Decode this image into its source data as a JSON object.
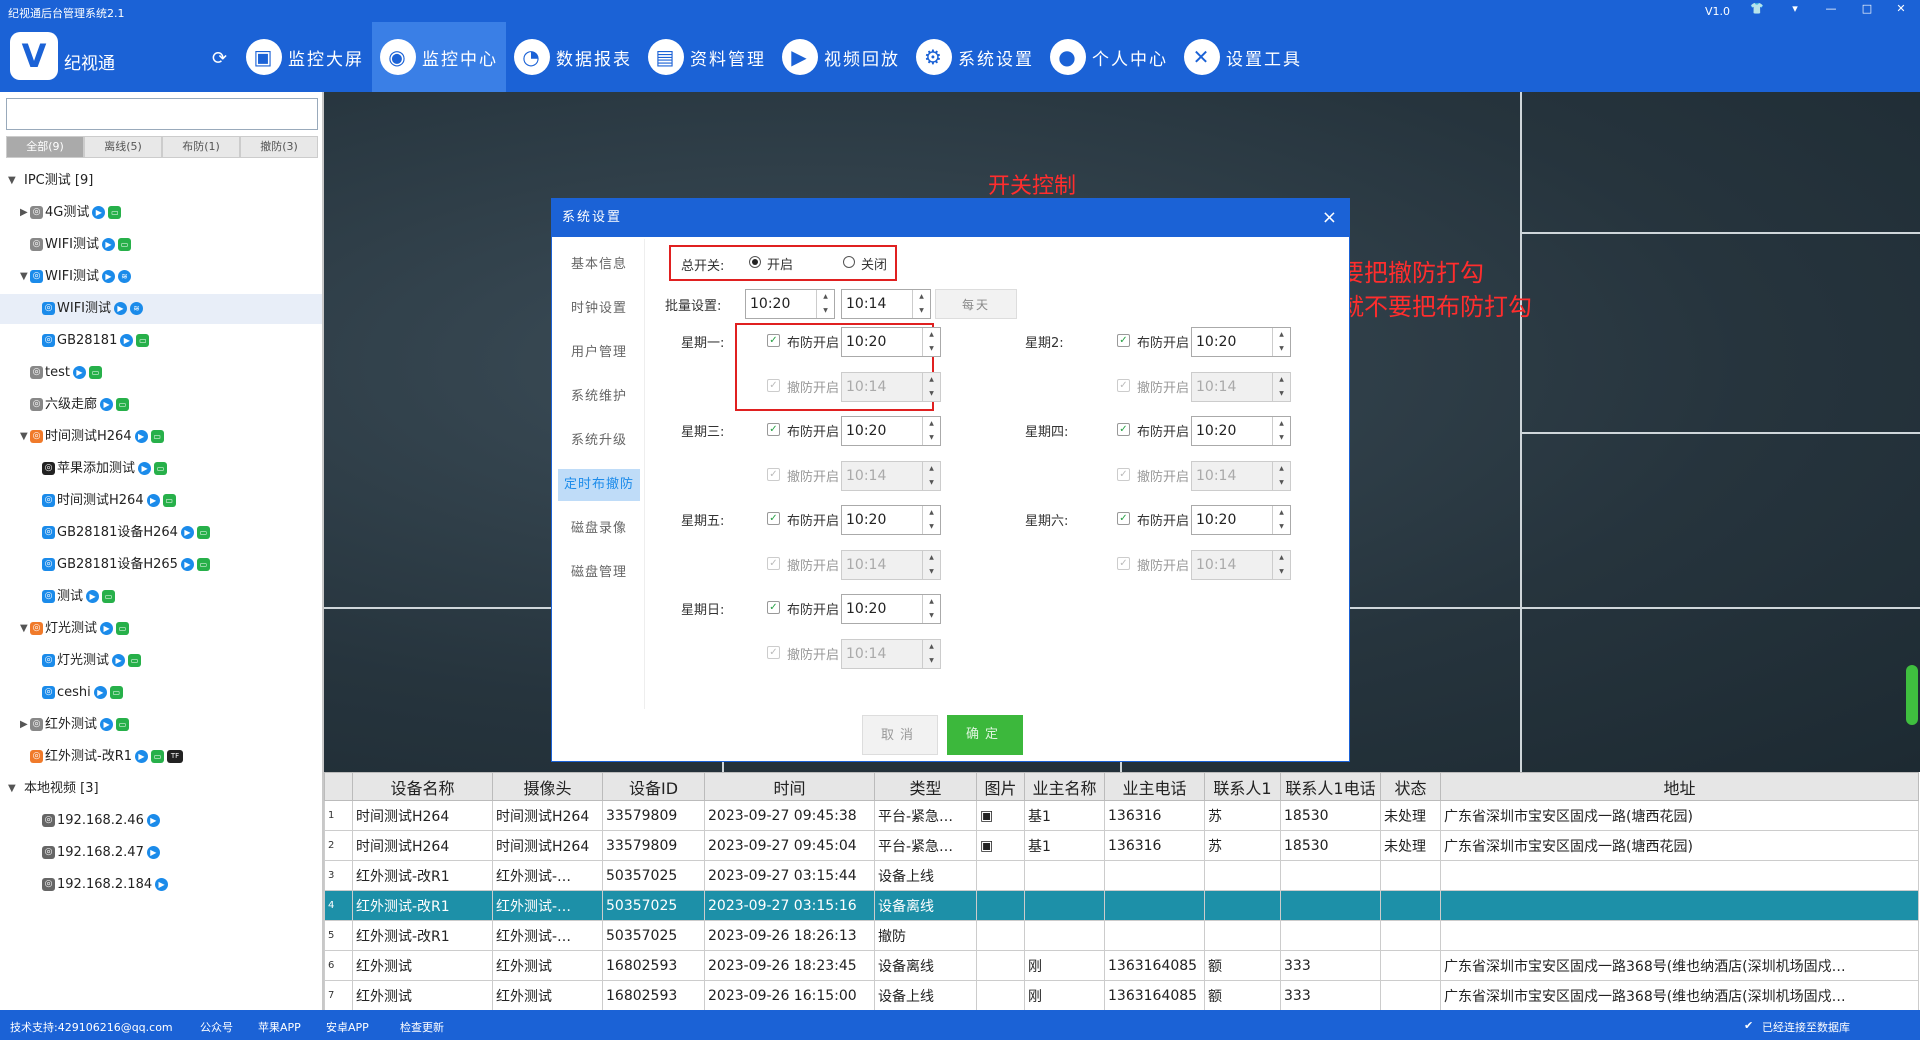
{
  "window": {
    "title": "纪视通后台管理系统2.1",
    "version": "V1.0"
  },
  "header": {
    "logo_glyph": "V",
    "app_name": "纪视通",
    "nav": [
      {
        "label": "监控大屏",
        "icon": "monitor-icon"
      },
      {
        "label": "监控中心",
        "icon": "camera-icon",
        "active": true
      },
      {
        "label": "数据报表",
        "icon": "pie-chart-icon"
      },
      {
        "label": "资料管理",
        "icon": "document-icon"
      },
      {
        "label": "视频回放",
        "icon": "play-icon"
      },
      {
        "label": "系统设置",
        "icon": "gear-icon"
      },
      {
        "label": "个人中心",
        "icon": "user-icon"
      },
      {
        "label": "设置工具",
        "icon": "tools-icon"
      }
    ]
  },
  "sidebar": {
    "search_placeholder": "",
    "filter_tabs": [
      "全部(9)",
      "离线(5)",
      "布防(1)",
      "撤防(3)"
    ],
    "tree": [
      {
        "label": "IPC测试 [9]",
        "level": 0,
        "expanded": true
      },
      {
        "label": "4G测试",
        "level": 1,
        "icon_color": "#888",
        "badges": [
          "play",
          "grn"
        ]
      },
      {
        "label": "WIFI测试",
        "level": 1,
        "icon_color": "#888",
        "badges": [
          "play",
          "grn"
        ]
      },
      {
        "label": "WIFI测试",
        "level": 1,
        "icon_color": "#1b8bea",
        "badges": [
          "play",
          "wifi"
        ],
        "expanded": true
      },
      {
        "label": "WIFI测试",
        "level": 2,
        "icon_color": "#1b8bea",
        "badges": [
          "play",
          "wifi"
        ],
        "selected": true
      },
      {
        "label": "GB28181",
        "level": 2,
        "icon_color": "#1b8bea",
        "badges": [
          "play",
          "grn"
        ]
      },
      {
        "label": "test",
        "level": 1,
        "icon_color": "#888",
        "badges": [
          "play",
          "grn"
        ]
      },
      {
        "label": "六级走廊",
        "level": 1,
        "icon_color": "#888",
        "badges": [
          "play",
          "grn"
        ]
      },
      {
        "label": "时间测试H264",
        "level": 1,
        "icon_color": "#f07a2a",
        "badges": [
          "play",
          "grn"
        ],
        "expanded": true
      },
      {
        "label": "苹果添加测试",
        "level": 2,
        "icon_color": "#222",
        "badges": [
          "play",
          "grn"
        ]
      },
      {
        "label": "时间测试H264",
        "level": 2,
        "icon_color": "#1b8bea",
        "badges": [
          "play",
          "grn"
        ]
      },
      {
        "label": "GB28181设备H264",
        "level": 2,
        "icon_color": "#1b8bea",
        "badges": [
          "play",
          "grn"
        ]
      },
      {
        "label": "GB28181设备H265",
        "level": 2,
        "icon_color": "#1b8bea",
        "badges": [
          "play",
          "grn"
        ]
      },
      {
        "label": "测试",
        "level": 2,
        "icon_color": "#1b8bea",
        "badges": [
          "play",
          "grn"
        ]
      },
      {
        "label": "灯光测试",
        "level": 1,
        "icon_color": "#f07a2a",
        "badges": [
          "play",
          "grn"
        ],
        "expanded": true
      },
      {
        "label": "灯光测试",
        "level": 2,
        "icon_color": "#1b8bea",
        "badges": [
          "play",
          "grn"
        ]
      },
      {
        "label": "ceshi",
        "level": 2,
        "icon_color": "#1b8bea",
        "badges": [
          "play",
          "grn"
        ]
      },
      {
        "label": "红外测试",
        "level": 1,
        "icon_color": "#888",
        "badges": [
          "play",
          "grn"
        ]
      },
      {
        "label": "红外测试-改R1",
        "level": 1,
        "icon_color": "#f07a2a",
        "badges": [
          "play",
          "grn",
          "TF"
        ]
      },
      {
        "label": "本地视频 [3]",
        "level": 0,
        "expanded": true
      },
      {
        "label": "192.168.2.46",
        "level": 2,
        "icon_color": "#666",
        "badges": [
          "play"
        ]
      },
      {
        "label": "192.168.2.47",
        "level": 2,
        "icon_color": "#666",
        "badges": [
          "play"
        ]
      },
      {
        "label": "192.168.2.184",
        "level": 2,
        "icon_color": "#666",
        "badges": [
          "play"
        ]
      }
    ]
  },
  "annotations": {
    "title": "开关控制",
    "line1": "只设置布防时间，就不要把撤防打勾",
    "line2": "同理只设置撤防时间，就不要把布防打勾"
  },
  "dialog": {
    "title": "系统设置",
    "close": "×",
    "menu": [
      "基本信息",
      "时钟设置",
      "用户管理",
      "系统维护",
      "系统升级",
      "定时布撤防",
      "磁盘录像",
      "磁盘管理"
    ],
    "active_menu": "定时布撤防",
    "master_label": "总开关:",
    "master_on": "开启",
    "master_off": "关闭",
    "batch_label": "批量设置:",
    "batch_start": "10:20",
    "batch_end": "10:14",
    "everyday_button": "每天",
    "arm_label": "布防开启",
    "disarm_label": "撤防开启",
    "days": [
      {
        "label": "星期一:",
        "arm_time": "10:20",
        "disarm_time": "10:14"
      },
      {
        "label": "星期2:",
        "arm_time": "10:20",
        "disarm_time": "10:14"
      },
      {
        "label": "星期三:",
        "arm_time": "10:20",
        "disarm_time": "10:14"
      },
      {
        "label": "星期四:",
        "arm_time": "10:20",
        "disarm_time": "10:14"
      },
      {
        "label": "星期五:",
        "arm_time": "10:20",
        "disarm_time": "10:14"
      },
      {
        "label": "星期六:",
        "arm_time": "10:20",
        "disarm_time": "10:14"
      },
      {
        "label": "星期日:",
        "arm_time": "10:20",
        "disarm_time": "10:14"
      }
    ],
    "cancel": "取消",
    "confirm": "确定"
  },
  "events_table": {
    "columns": [
      "",
      "设备名称",
      "摄像头",
      "设备ID",
      "时间",
      "类型",
      "图片",
      "业主名称",
      "业主电话",
      "联系人1",
      "联系人1电话",
      "状态",
      "地址"
    ],
    "rows": [
      [
        "1",
        "时间测试H264",
        "时间测试H264",
        "33579809",
        "2023-09-27 09:45:38",
        "平台-紧急…",
        "▣",
        "基1",
        "136316",
        "苏",
        "18530",
        "未处理",
        "广东省深圳市宝安区固戍一路(塘西花园)"
      ],
      [
        "2",
        "时间测试H264",
        "时间测试H264",
        "33579809",
        "2023-09-27 09:45:04",
        "平台-紧急…",
        "▣",
        "基1",
        "136316",
        "苏",
        "18530",
        "未处理",
        "广东省深圳市宝安区固戍一路(塘西花园)"
      ],
      [
        "3",
        "红外测试-改R1",
        "红外测试-…",
        "50357025",
        "2023-09-27 03:15:44",
        "设备上线",
        "",
        "",
        "",
        "",
        "",
        "",
        ""
      ],
      [
        "4",
        "红外测试-改R1",
        "红外测试-…",
        "50357025",
        "2023-09-27 03:15:16",
        "设备离线",
        "",
        "",
        "",
        "",
        "",
        "",
        ""
      ],
      [
        "5",
        "红外测试-改R1",
        "红外测试-…",
        "50357025",
        "2023-09-26 18:26:13",
        "撤防",
        "",
        "",
        "",
        "",
        "",
        "",
        ""
      ],
      [
        "6",
        "红外测试",
        "红外测试",
        "16802593",
        "2023-09-26 18:23:45",
        "设备离线",
        "",
        "刚",
        "1363164085",
        "额",
        "333",
        "",
        "广东省深圳市宝安区固戍一路368号(维也纳酒店(深圳机场固戍…"
      ],
      [
        "7",
        "红外测试",
        "红外测试",
        "16802593",
        "2023-09-26 16:15:00",
        "设备上线",
        "",
        "刚",
        "1363164085",
        "额",
        "333",
        "",
        "广东省深圳市宝安区固戍一路368号(维也纳酒店(深圳机场固戍…"
      ]
    ],
    "selected_row": 3
  },
  "statusbar": {
    "support": "技术支持:429106216@qq.com",
    "links": [
      "公众号",
      "苹果APP",
      "安卓APP",
      "检查更新"
    ],
    "db_status": "已经连接至数据库"
  },
  "colors": {
    "primary": "#1b62d6",
    "confirm": "#3cb83c",
    "annotation": "#ff2d2d",
    "selected_row": "#1d90a8"
  }
}
